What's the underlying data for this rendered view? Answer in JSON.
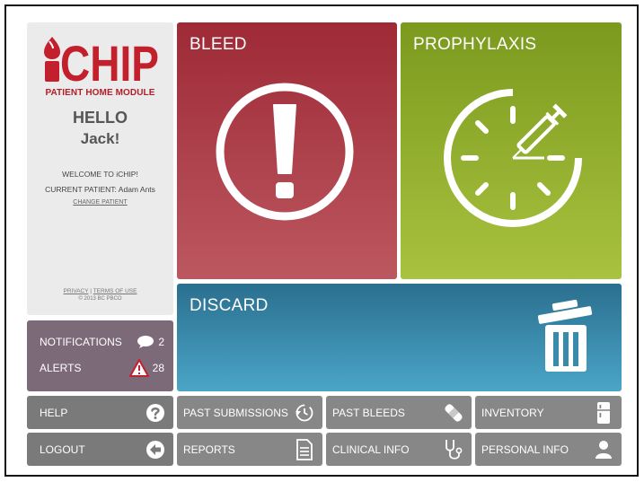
{
  "app": {
    "logo_text": "iCHIP",
    "module_title": "PATIENT HOME MODULE"
  },
  "greeting": {
    "hello": "HELLO",
    "name": "Jack!",
    "welcome": "WELCOME TO iCHIP!",
    "current_patient": "CURRENT PATIENT: Adam Ants",
    "change_patient": "CHANGE PATIENT"
  },
  "footer": {
    "privacy": "PRIVACY",
    "separator": "|",
    "terms": "TERMS OF USE",
    "copyright": "© 2013 BC PBCO"
  },
  "notifications": {
    "label": "NOTIFICATIONS",
    "count": "2",
    "icon": "speech-bubble-icon"
  },
  "alerts": {
    "label": "ALERTS",
    "count": "28",
    "icon": "warning-triangle-icon"
  },
  "tiles": {
    "bleed": {
      "label": "BLEED",
      "icon": "exclamation-circle-icon",
      "color": "#a83a45"
    },
    "prophylaxis": {
      "label": "PROPHYLAXIS",
      "icon": "clock-syringe-icon",
      "color": "#8fae2c"
    },
    "discard": {
      "label": "DISCARD",
      "icon": "trash-icon",
      "color": "#3a8aab"
    }
  },
  "buttons": {
    "help": {
      "label": "HELP",
      "icon": "question-icon"
    },
    "logout": {
      "label": "LOGOUT",
      "icon": "arrow-left-icon"
    },
    "past_submissions": {
      "label": "PAST SUBMISSIONS",
      "icon": "history-clock-icon"
    },
    "reports": {
      "label": "REPORTS",
      "icon": "document-icon"
    },
    "past_bleeds": {
      "label": "PAST BLEEDS",
      "icon": "bandage-icon"
    },
    "clinical_info": {
      "label": "CLINICAL INFO",
      "icon": "stethoscope-icon"
    },
    "inventory": {
      "label": "INVENTORY",
      "icon": "fridge-icon"
    },
    "personal_info": {
      "label": "PERSONAL INFO",
      "icon": "person-icon"
    }
  }
}
